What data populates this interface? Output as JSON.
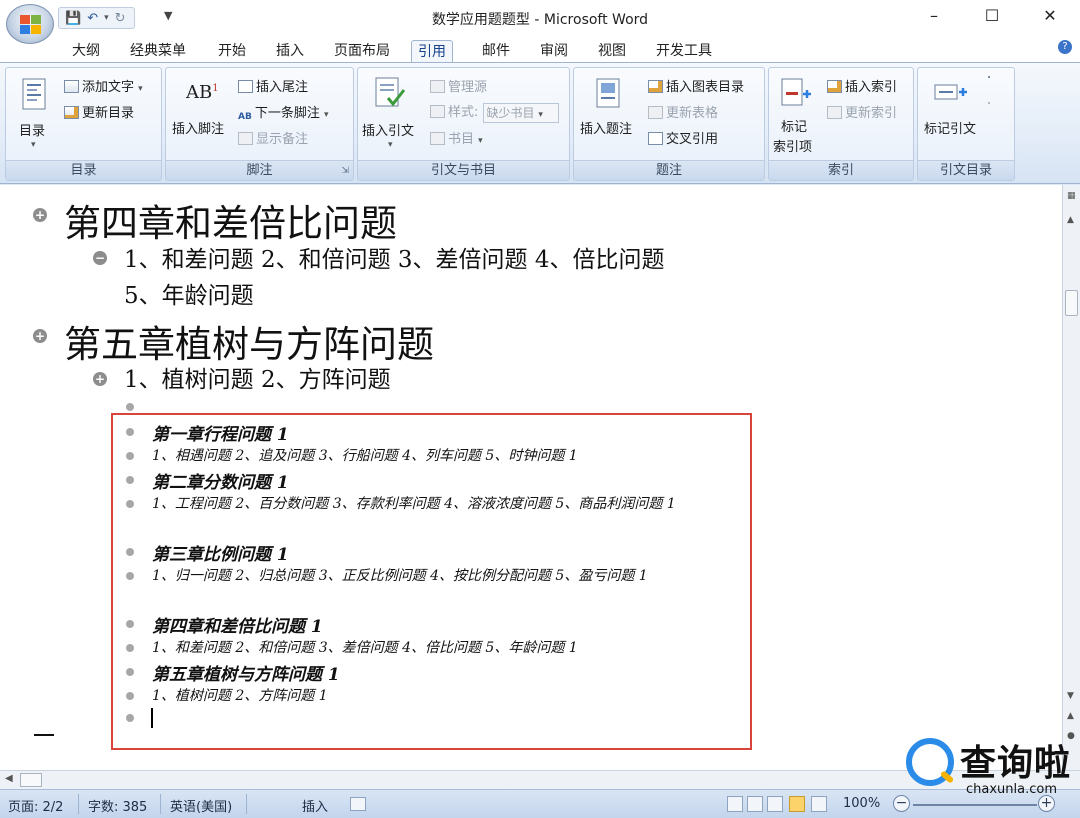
{
  "window": {
    "title": "数学应用题题型 - Microsoft Word",
    "minimize": "–",
    "maximize": "☐",
    "close": "✕"
  },
  "qat": {
    "save_icon": "save-icon",
    "undo_icon": "undo-icon",
    "redo_icon": "redo-icon"
  },
  "tabs": [
    "大纲",
    "经典菜单",
    "开始",
    "插入",
    "页面布局",
    "引用",
    "邮件",
    "审阅",
    "视图",
    "开发工具"
  ],
  "active_tab": "引用",
  "ribbon": {
    "toc": {
      "label": "目录",
      "big_button": "目录",
      "add_text": "添加文字",
      "update": "更新目录"
    },
    "footnotes": {
      "label": "脚注",
      "insert_footnote": "插入脚注",
      "insert_endnote": "插入尾注",
      "next_footnote": "下一条脚注",
      "show_notes": "显示备注"
    },
    "citations": {
      "label": "引文与书目",
      "insert_citation": "插入引文",
      "manage_sources": "管理源",
      "style": "样式:",
      "style_value": "缺少书目",
      "bibliography": "书目"
    },
    "captions": {
      "label": "题注",
      "insert_caption": "插入题注",
      "insert_table_of_figures": "插入图表目录",
      "update_table": "更新表格",
      "cross_reference": "交叉引用"
    },
    "index": {
      "label": "索引",
      "mark_entry_line1": "标记",
      "mark_entry_line2": "索引项",
      "insert_index": "插入索引",
      "update_index": "更新索引"
    },
    "toa": {
      "label": "引文目录",
      "mark_citation": "标记引文"
    }
  },
  "document": {
    "headings": [
      {
        "title": "第四章和差倍比问题",
        "sub": "1、和差问题 2、和倍问题 3、差倍问题 4、倍比问题 5、年龄问题"
      },
      {
        "title": "第五章植树与方阵问题",
        "sub": "1、植树问题 2、方阵问题"
      }
    ],
    "toc_entries": [
      {
        "text": "第一章行程问题 1",
        "level": "h"
      },
      {
        "text": "1、相遇问题 2、追及问题 3、行船问题 4、列车问题 5、时钟问题 1",
        "level": "s"
      },
      {
        "text": "第二章分数问题 1",
        "level": "h"
      },
      {
        "text": "1、工程问题 2、百分数问题 3、存款利率问题 4、溶液浓度问题 5、商品利润问题 1",
        "level": "s"
      },
      {
        "text": "第三章比例问题 1",
        "level": "h"
      },
      {
        "text": "1、归一问题 2、归总问题 3、正反比例问题 4、按比例分配问题 5、盈亏问题 1",
        "level": "s"
      },
      {
        "text": "第四章和差倍比问题 1",
        "level": "h"
      },
      {
        "text": "1、和差问题 2、和倍问题 3、差倍问题 4、倍比问题 5、年龄问题 1",
        "level": "s"
      },
      {
        "text": "第五章植树与方阵问题 1",
        "level": "h"
      },
      {
        "text": "1、植树问题 2、方阵问题 1",
        "level": "s"
      }
    ]
  },
  "status": {
    "page": "页面: 2/2",
    "words": "字数: 385",
    "language": "英语(美国)",
    "mode": "插入",
    "zoom": "100%",
    "zoom_minus": "−",
    "zoom_plus": "+"
  },
  "watermark": {
    "text": "查询啦",
    "sub": "chaxunla.com"
  },
  "colors": {
    "accent": "#15428b",
    "highlight_box": "#d9443a"
  }
}
